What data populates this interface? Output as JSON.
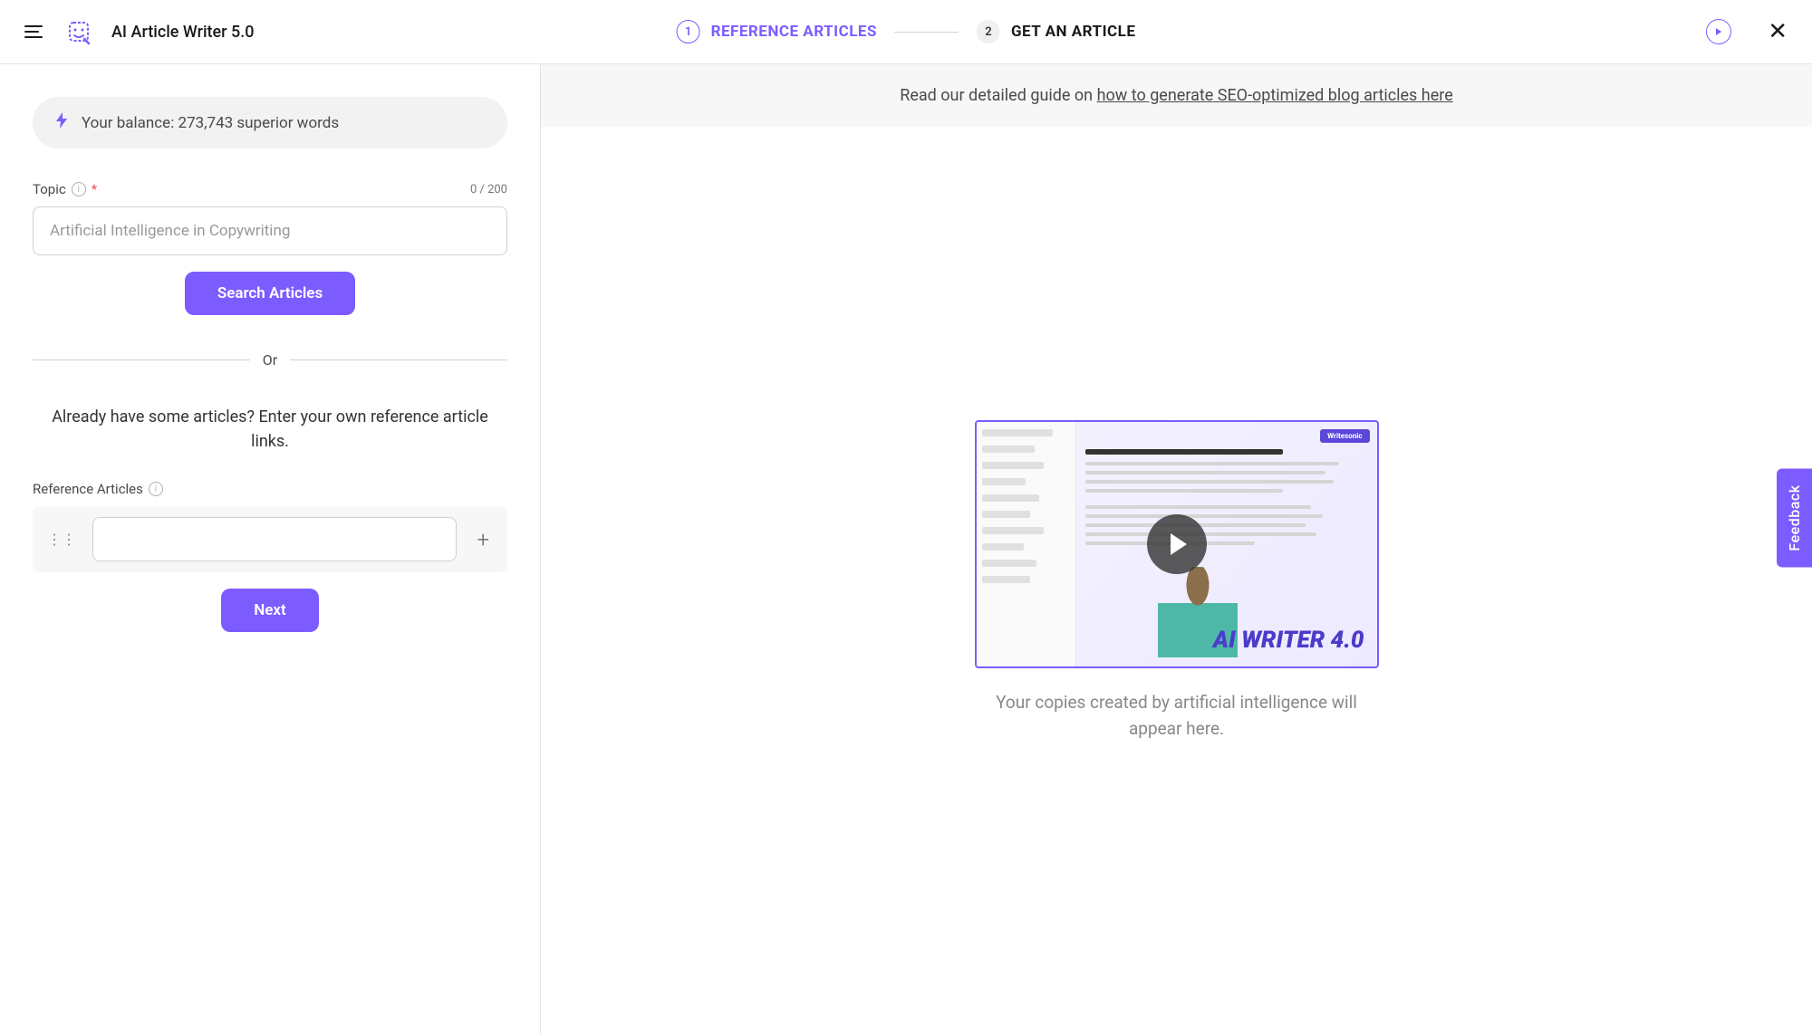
{
  "header": {
    "app_title": "AI Article Writer 5.0",
    "steps": [
      {
        "num": "1",
        "label": "REFERENCE ARTICLES",
        "active": true
      },
      {
        "num": "2",
        "label": "GET AN ARTICLE",
        "active": false
      }
    ]
  },
  "sidebar": {
    "balance_text": "Your balance: 273,743 superior words",
    "topic": {
      "label": "Topic",
      "placeholder": "Artificial Intelligence in Copywriting",
      "char_count": "0 / 200",
      "required_marker": "*"
    },
    "search_button": "Search Articles",
    "or_text": "Or",
    "own_articles_text": "Already have some articles? Enter your own reference article links.",
    "reference_label": "Reference Articles",
    "next_button": "Next"
  },
  "content": {
    "guide_prefix": "Read our detailed guide on ",
    "guide_link": "how to generate SEO-optimized blog articles here",
    "preview_badge": "Writesonic",
    "preview_big_text": "AI WRITER 4.0",
    "placeholder_text": "Your copies created by artificial intelligence will appear here."
  },
  "feedback_label": "Feedback"
}
